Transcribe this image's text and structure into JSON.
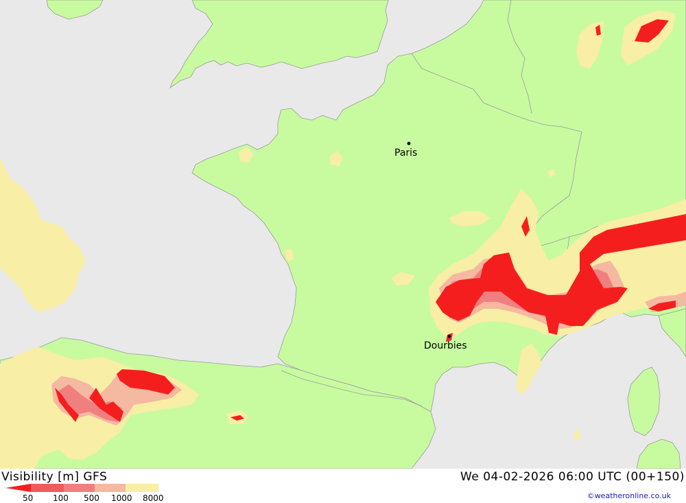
{
  "map": {
    "cities": [
      {
        "id": "paris",
        "name": "Paris"
      },
      {
        "id": "dourbies",
        "name": "Dourbies"
      }
    ],
    "colors": {
      "sea": "#e9e9e9",
      "land": "#c8fba0",
      "border": "#9a9a9a",
      "vis_8000": "#f8eea6",
      "vis_1000": "#f5b8a0",
      "vis_500": "#f08080",
      "vis_100": "#f25a5a",
      "vis_50": "#f51e1e"
    }
  },
  "footer": {
    "title_left": "Visibility [m] GFS",
    "title_right": "We 04-02-2026 06:00 UTC (00+150)",
    "credit": "©weatheronline.co.uk",
    "legend": {
      "ticks": [
        "50",
        "100",
        "500",
        "1000",
        "8000"
      ],
      "colors": [
        "#f51e1e",
        "#f25a5a",
        "#f08080",
        "#f5b8a0",
        "#f8eea6"
      ]
    }
  }
}
